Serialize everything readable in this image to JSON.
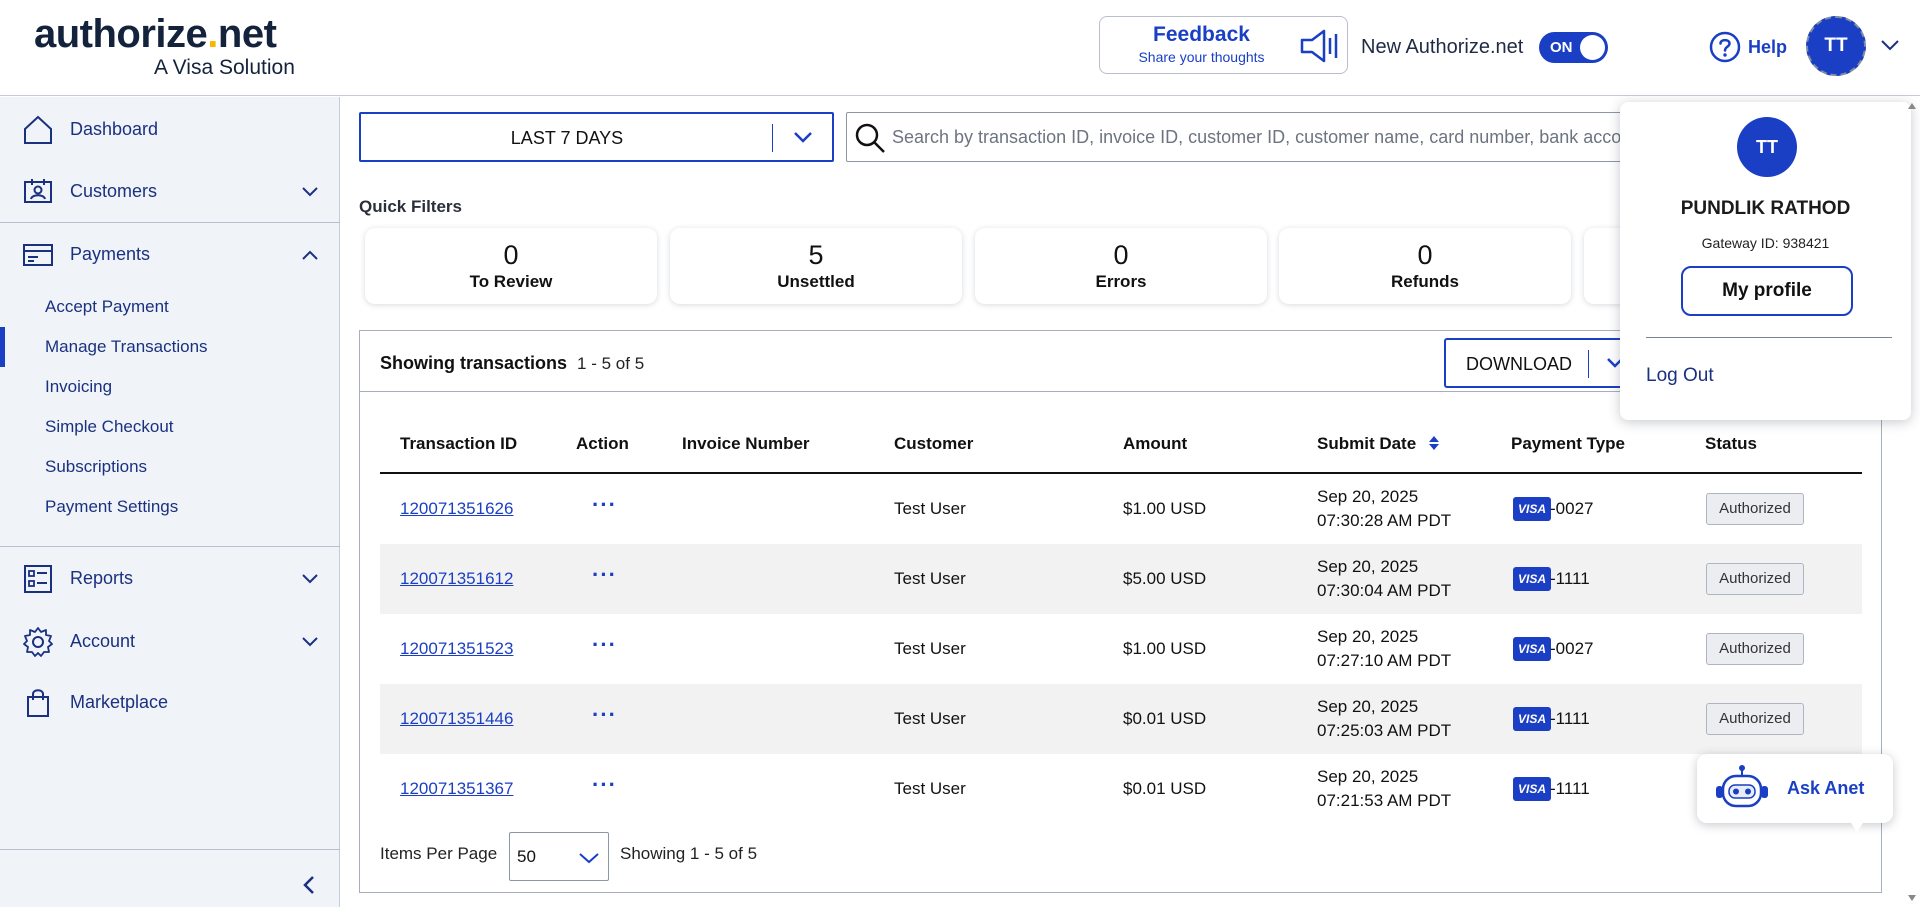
{
  "brand": {
    "name_part1": "authorize",
    "name_dot": ".",
    "name_part2": "net",
    "tagline": "A Visa Solution",
    "accent": "#1a3fc4",
    "logo_dot_color": "#f7b600"
  },
  "header": {
    "feedback_title": "Feedback",
    "feedback_sub": "Share your thoughts",
    "new_anet_label": "New Authorize.net",
    "toggle_label": "ON",
    "help_label": "Help",
    "avatar_initials": "TT"
  },
  "sidebar": {
    "dashboard": "Dashboard",
    "customers": "Customers",
    "payments": "Payments",
    "payments_sub": [
      "Accept Payment",
      "Manage Transactions",
      "Invoicing",
      "Simple Checkout",
      "Subscriptions",
      "Payment Settings"
    ],
    "reports": "Reports",
    "account": "Account",
    "marketplace": "Marketplace"
  },
  "filters": {
    "date_range": "LAST 7 DAYS",
    "search_placeholder": "Search by transaction ID, invoice ID, customer ID, customer name, card number, bank account number",
    "quick_filters_title": "Quick Filters",
    "quick": [
      {
        "count": "0",
        "label": "To Review"
      },
      {
        "count": "5",
        "label": "Unsettled"
      },
      {
        "count": "0",
        "label": "Errors"
      },
      {
        "count": "0",
        "label": "Refunds"
      }
    ]
  },
  "table": {
    "showing_label": "Showing transactions",
    "showing_range": "1 - 5 of 5",
    "download_label": "DOWNLOAD",
    "columns": [
      "Transaction ID",
      "Action",
      "Invoice Number",
      "Customer",
      "Amount",
      "Submit Date",
      "Payment Type",
      "Status"
    ],
    "action_glyph": "···",
    "card_brand": "VISA",
    "rows": [
      {
        "id": "120071351626",
        "invoice": "",
        "customer": "Test User",
        "amount": "$1.00 USD",
        "date": "Sep 20, 2025",
        "time": "07:30:28 AM PDT",
        "last4": "-0027",
        "status": "Authorized"
      },
      {
        "id": "120071351612",
        "invoice": "",
        "customer": "Test User",
        "amount": "$5.00 USD",
        "date": "Sep 20, 2025",
        "time": "07:30:04 AM PDT",
        "last4": "-1111",
        "status": "Authorized"
      },
      {
        "id": "120071351523",
        "invoice": "",
        "customer": "Test User",
        "amount": "$1.00 USD",
        "date": "Sep 20, 2025",
        "time": "07:27:10 AM PDT",
        "last4": "-0027",
        "status": "Authorized"
      },
      {
        "id": "120071351446",
        "invoice": "",
        "customer": "Test User",
        "amount": "$0.01 USD",
        "date": "Sep 20, 2025",
        "time": "07:25:03 AM PDT",
        "last4": "-1111",
        "status": "Authorized"
      },
      {
        "id": "120071351367",
        "invoice": "",
        "customer": "Test User",
        "amount": "$0.01 USD",
        "date": "Sep 20, 2025",
        "time": "07:21:53 AM PDT",
        "last4": "-1111",
        "status": ""
      }
    ],
    "items_per_page_label": "Items Per Page",
    "items_per_page_value": "50",
    "footer_showing": "Showing 1 - 5 of 5"
  },
  "profile_menu": {
    "initials": "TT",
    "name": "PUNDLIK RATHOD",
    "gateway": "Gateway ID: 938421",
    "my_profile": "My profile",
    "logout": "Log Out"
  },
  "assistant": {
    "label": "Ask Anet"
  }
}
